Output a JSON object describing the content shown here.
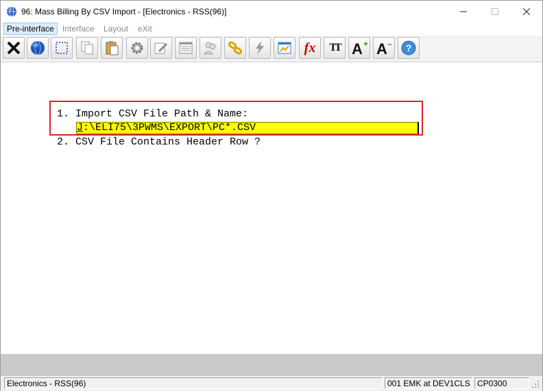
{
  "window": {
    "title": "96: Mass Billing By CSV Import - [Electronics - RSS(96)]",
    "controls": {
      "minimize": "—",
      "maximize": "☐",
      "close": "✕"
    }
  },
  "menu": [
    {
      "label": "Pre-interface",
      "active": true
    },
    {
      "label": "Interface",
      "active": false
    },
    {
      "label": "Layout",
      "active": false
    },
    {
      "label": "eXit",
      "active": false
    }
  ],
  "toolbar": {
    "icons": [
      "close-x-icon",
      "globe-icon",
      "select-frame-icon",
      "copy-icon",
      "paste-icon",
      "settings-gear-icon",
      "edit-form-icon",
      "list-icon",
      "users-icon",
      "link-chain-icon",
      "lightning-icon",
      "chart-report-icon",
      "function-fx-icon",
      "font-tt-icon",
      "font-increase-icon",
      "font-decrease-icon",
      "help-icon"
    ],
    "fx_label": "fx",
    "tt_label": "TT",
    "a_label": "A",
    "help_label": "?"
  },
  "form": {
    "line1": "1. Import CSV File Path & Name:",
    "input_first_char": "J",
    "input_rest": ":\\ELI75\\3PWMS\\EXPORT\\PC*.CSV",
    "line2": "2. CSV File Contains Header Row ?"
  },
  "status": {
    "company": "Electronics - RSS(96)",
    "session": "001 EMK at DEV1CLS",
    "program": "CP0300"
  },
  "colors": {
    "input_bg": "#ffff00",
    "highlight_border": "#e0202e",
    "menu_active_bg": "#dcebfa"
  }
}
